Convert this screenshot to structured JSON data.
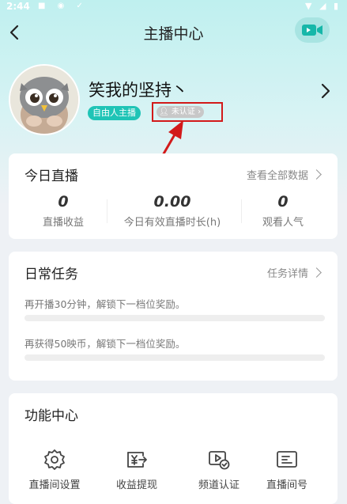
{
  "status_bar": {
    "time": "2:44"
  },
  "nav": {
    "title": "主播中心"
  },
  "profile": {
    "name": "笑我的坚持丶",
    "badge_free": "自由人主播",
    "cert_status": "未认证"
  },
  "today_live": {
    "title": "今日直播",
    "link": "查看全部数据",
    "stats": [
      {
        "value": "0",
        "label": "直播收益"
      },
      {
        "value": "0.00",
        "label": "今日有效直播时长(h)"
      },
      {
        "value": "0",
        "label": "观看人气"
      }
    ]
  },
  "daily_tasks": {
    "title": "日常任务",
    "link": "任务详情",
    "tasks": [
      {
        "text": "再开播30分钟，解锁下一档位奖励。",
        "progress": 0
      },
      {
        "text": "再获得50映币，解锁下一档位奖励。",
        "progress": 0
      }
    ]
  },
  "function_center": {
    "title": "功能中心",
    "items": [
      {
        "label": "直播间设置",
        "icon": "settings-icon"
      },
      {
        "label": "收益提现",
        "icon": "withdraw-icon"
      },
      {
        "label": "频道认证",
        "icon": "channel-verify-icon"
      },
      {
        "label": "直播间号",
        "icon": "room-id-icon"
      }
    ]
  },
  "colors": {
    "accent": "#1fc4b6",
    "header_bg": "#bff0ef",
    "highlight_box": "#d21a1a"
  }
}
